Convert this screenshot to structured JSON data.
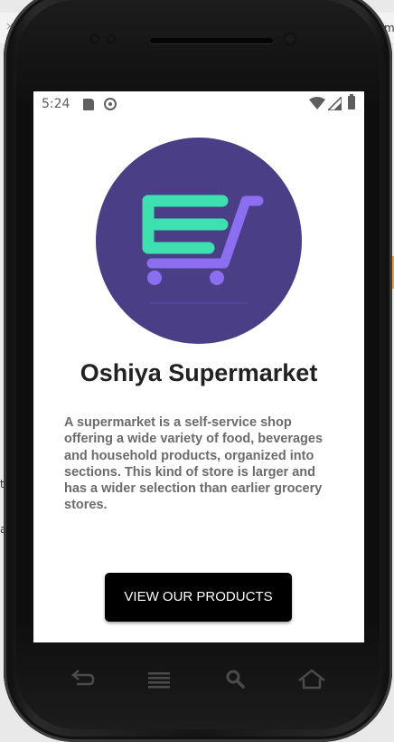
{
  "status_bar": {
    "time": "5:24"
  },
  "app": {
    "title": "Oshiya Supermarket",
    "description": "A supermarket is a self-service shop offering a wide variety of food, beverages and household products, organized into sections. This kind of store is larger and has a wider selection than earlier grocery stores.",
    "button_label": "VIEW OUR PRODUCTS",
    "logo_icon": "shopping-cart-logo",
    "colors": {
      "logo_bg": "#4a3f86",
      "cart_green": "#3ee0b0",
      "cart_purple": "#8c6ff0",
      "button_bg": "#000000"
    }
  },
  "device_nav": [
    "back",
    "menu",
    "search",
    "home"
  ],
  "background_fragments": {
    "tab_fragment": "ma",
    "left_letter_1": "t",
    "left_letter_2": "a"
  }
}
